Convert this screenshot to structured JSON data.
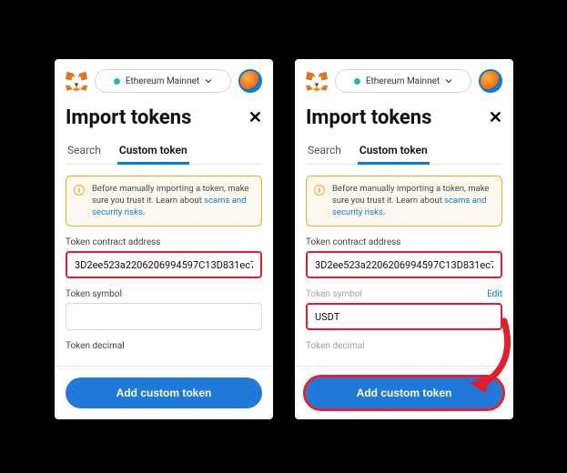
{
  "network": {
    "label": "Ethereum Mainnet"
  },
  "page": {
    "title": "Import tokens"
  },
  "tabs": {
    "search": "Search",
    "custom": "Custom token"
  },
  "warning": {
    "text_before": "Before manually importing a token, make sure you trust it. Learn about ",
    "link": "scams and security risks",
    "text_after": "."
  },
  "fields": {
    "address_label": "Token contract address",
    "symbol_label": "Token symbol",
    "decimal_label": "Token decimal",
    "edit": "Edit"
  },
  "left": {
    "address_value": "3D2ee523a2206206994597C13D831ec7",
    "symbol_value": "",
    "decimal_value": ""
  },
  "right": {
    "address_value": "3D2ee523a2206206994597C13D831ec7",
    "symbol_value": "USDT",
    "decimal_value": ""
  },
  "button": {
    "add": "Add custom token"
  }
}
